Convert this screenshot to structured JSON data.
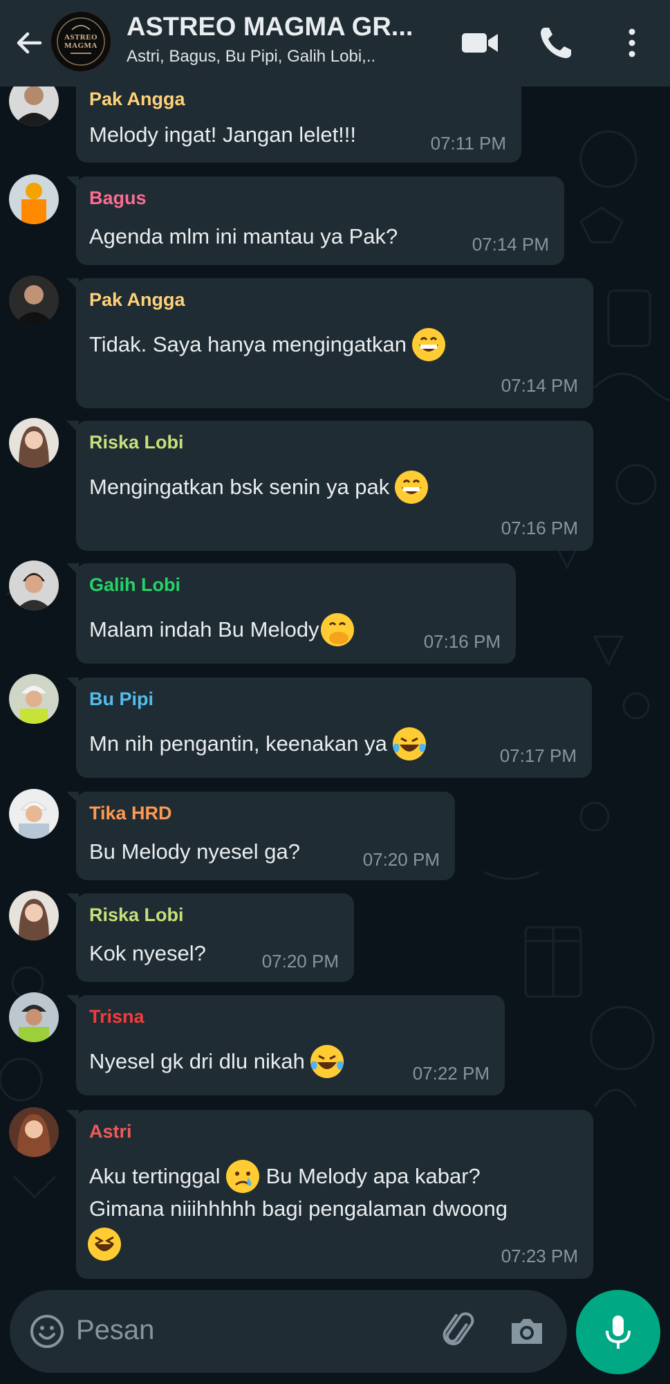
{
  "header": {
    "back_icon": "arrow-left-icon",
    "title": "ASTREO MAGMA GR...",
    "members": "Astri, Bagus, Bu Pipi, Galih Lobi,..",
    "avatar_logo_text": "ASTREO MAGMA",
    "video_icon": "video-camera-icon",
    "call_icon": "phone-icon",
    "menu_icon": "more-vertical-icon"
  },
  "messages": [
    {
      "sender": "Pak Angga",
      "sender_color": "#ffd279",
      "text": "Melody ingat! Jangan lelet!!!",
      "time": "07:11 PM"
    },
    {
      "sender": "Bagus",
      "sender_color": "#fd6c93",
      "text": "Agenda mlm ini mantau ya Pak?",
      "time": "07:14 PM"
    },
    {
      "sender": "Pak Angga",
      "sender_color": "#ffd279",
      "text": "Tidak. Saya hanya mengingatkan",
      "emoji": "grinning-face-icon",
      "time": "07:14 PM"
    },
    {
      "sender": "Riska Lobi",
      "sender_color": "#c6e07b",
      "text": "Mengingatkan bsk senin ya pak",
      "emoji": "grinning-face-icon",
      "time": "07:16 PM"
    },
    {
      "sender": "Galih Lobi",
      "sender_color": "#25d366",
      "text": "Malam indah Bu Melody",
      "emoji": "hand-over-mouth-icon",
      "time": "07:16 PM"
    },
    {
      "sender": "Bu Pipi",
      "sender_color": "#53bdeb",
      "text": "Mn nih pengantin, keenakan ya",
      "emoji": "tears-of-joy-icon",
      "time": "07:17 PM"
    },
    {
      "sender": "Tika HRD",
      "sender_color": "#ff9a52",
      "text": "Bu Melody nyesel ga?",
      "time": "07:20 PM"
    },
    {
      "sender": "Riska Lobi",
      "sender_color": "#c6e07b",
      "text": "Kok nyesel?",
      "time": "07:20 PM"
    },
    {
      "sender": "Trisna",
      "sender_color": "#f53b3b",
      "text": "Nyesel gk dri dlu nikah",
      "emoji": "tears-of-joy-icon",
      "time": "07:22 PM"
    },
    {
      "sender": "Astri",
      "sender_color": "#f05a5a",
      "text_line1a": "Aku tertinggal",
      "emoji_mid": "crying-face-icon",
      "text_line1b": "Bu Melody apa kabar?",
      "text_line2": "Gimana niiihhhhh bagi pengalaman dwoong",
      "emoji": "squinting-laugh-icon",
      "time": "07:23 PM"
    }
  ],
  "input": {
    "placeholder": "Pesan",
    "emoji_icon": "smiley-icon",
    "attach_icon": "paperclip-icon",
    "camera_icon": "camera-icon",
    "mic_icon": "microphone-icon"
  },
  "colors": {
    "background": "#0b141a",
    "header": "#1f2c34",
    "bubble": "#1f2c33",
    "accent": "#00a884",
    "timestamp": "#8696a0"
  }
}
